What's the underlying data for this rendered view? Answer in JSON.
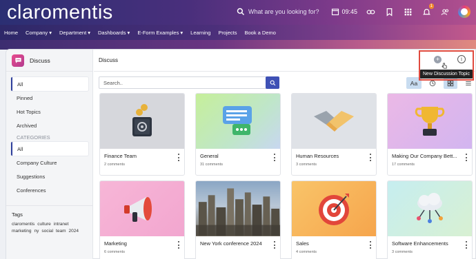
{
  "header": {
    "logo": "claromentis",
    "search_placeholder": "What are you looking for?",
    "time": "09:45",
    "notification_count": "1"
  },
  "nav": {
    "items": [
      "Home",
      "Company ▾",
      "Department ▾",
      "Dashboards ▾",
      "E-Form Examples ▾",
      "Learning",
      "Projects",
      "Book a Demo"
    ]
  },
  "sidebar": {
    "app_title": "Discuss",
    "items": [
      "All",
      "Pinned",
      "Hot Topics",
      "Archived"
    ],
    "categories_label": "CATEGORIES",
    "categories": [
      "All",
      "Company Culture",
      "Suggestions",
      "Conferences"
    ],
    "tags_title": "Tags",
    "tags": [
      "claromentis",
      "culture",
      "intranet",
      "marketing",
      "ny",
      "social",
      "team",
      "2024"
    ]
  },
  "main": {
    "title": "Discuss",
    "search_placeholder": "Search..",
    "font_toggle": "Aa",
    "tooltip": "New Discussion Topic",
    "cards": [
      {
        "title": "Finance Team",
        "sub": "2 comments",
        "icon": "safe-icon"
      },
      {
        "title": "General",
        "sub": "31 comments",
        "icon": "chat-bubbles-icon"
      },
      {
        "title": "Human Resources",
        "sub": "3 comments",
        "icon": "handshake-icon"
      },
      {
        "title": "Making Our Company Bett...",
        "sub": "17 comments",
        "icon": "trophy-icon"
      },
      {
        "title": "Marketing",
        "sub": "6 comments",
        "icon": "megaphone-icon"
      },
      {
        "title": "New York conference 2024",
        "sub": "",
        "icon": "city-skyline-photo"
      },
      {
        "title": "Sales",
        "sub": "4 comments",
        "icon": "target-icon"
      },
      {
        "title": "Software Enhancements",
        "sub": "3 comments",
        "icon": "cloud-network-icon"
      }
    ]
  },
  "colors": {
    "accent": "#3f51b5",
    "highlight": "#e04a3e"
  }
}
